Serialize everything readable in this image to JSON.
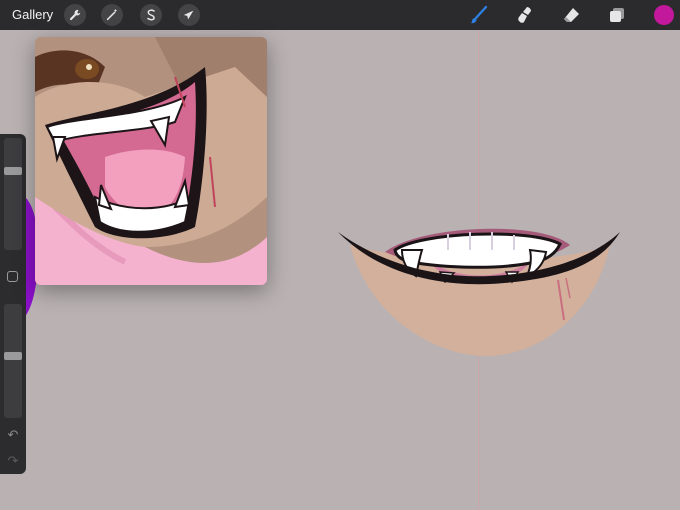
{
  "topbar": {
    "gallery_label": "Gallery",
    "left_tools": [
      {
        "name": "actions",
        "icon": "wrench-icon"
      },
      {
        "name": "adjustments",
        "icon": "magic-wand-icon"
      },
      {
        "name": "selection",
        "icon": "selection-s-icon"
      },
      {
        "name": "transform",
        "icon": "arrow-cursor-icon"
      }
    ],
    "right_tools": [
      {
        "name": "brush",
        "icon": "brush-icon",
        "active": true
      },
      {
        "name": "smudge",
        "icon": "smudge-icon"
      },
      {
        "name": "eraser",
        "icon": "eraser-icon"
      },
      {
        "name": "layers",
        "icon": "layers-icon"
      }
    ],
    "current_color": "#c2189c",
    "active_tool_color": "#2e7fe0"
  },
  "sidebar": {
    "brush_size_level": 0.72,
    "opacity_level": 0.55,
    "undo_icon": "undo-icon",
    "redo_icon": "redo-icon"
  },
  "reference_window": {
    "icon": "reference-image-lion-mouth"
  },
  "colors": {
    "canvas_bg": "#b9b1b2",
    "skin": "#d2b09c",
    "lip_dark": "#1b1416",
    "gum_pink": "#a65a7a",
    "teeth": "#ffffff",
    "accent_purple": "#8a10c8"
  }
}
